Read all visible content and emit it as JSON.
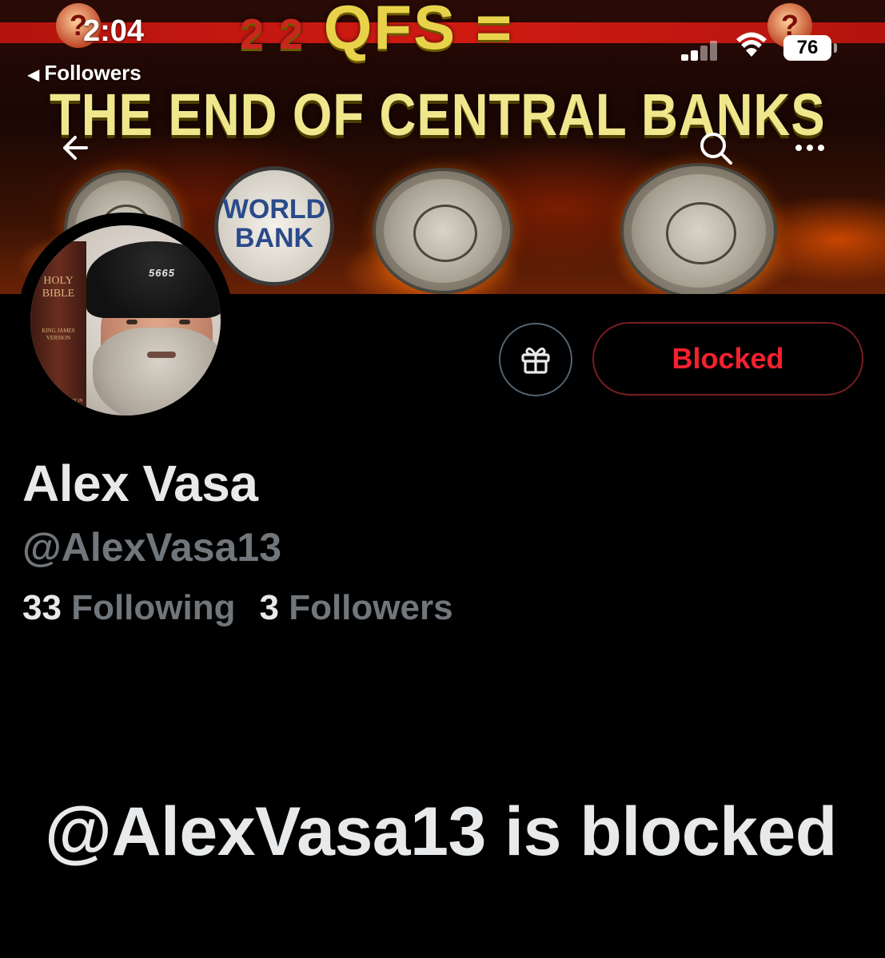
{
  "status_bar": {
    "time": "2:04",
    "back_label": "Followers",
    "battery_level": "76"
  },
  "banner": {
    "qfs_numbers": "2 2",
    "qfs_text": "QFS =",
    "headline": "THE END OF CENTRAL BANKS",
    "world_bank_line1": "WORLD",
    "world_bank_line2": "BANK"
  },
  "avatar": {
    "bible_title": "HOLY BIBLE",
    "bible_edition": "KING JAMES VERSION",
    "bible_footer": "WORDS OF CHRIST IN RED",
    "beanie_text": "5665"
  },
  "actions": {
    "blocked_label": "Blocked"
  },
  "profile": {
    "display_name": "Alex Vasa",
    "handle": "@AlexVasa13",
    "following_count": "33",
    "following_label": "Following",
    "followers_count": "3",
    "followers_label": "Followers"
  },
  "blocked_notice": "@AlexVasa13 is blocked",
  "colors": {
    "background": "#000000",
    "primary_text": "#e7e9ea",
    "secondary_text": "#71767b",
    "blocked_red": "#f4212e",
    "button_border": "#536471"
  },
  "icons": {
    "back": "arrow-left-icon",
    "search": "search-icon",
    "more": "more-horizontal-icon",
    "gift": "gift-icon",
    "signal": "cellular-signal-icon",
    "wifi": "wifi-icon",
    "battery": "battery-icon"
  }
}
